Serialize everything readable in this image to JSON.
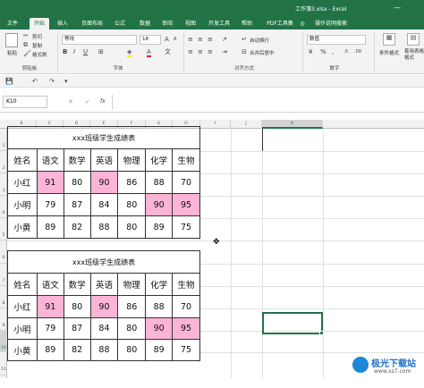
{
  "window": {
    "title": "工作簿3.xlsx - Excel"
  },
  "tabs": [
    {
      "label": "文件"
    },
    {
      "label": "开始"
    },
    {
      "label": "插入"
    },
    {
      "label": "页面布局"
    },
    {
      "label": "公式"
    },
    {
      "label": "数据"
    },
    {
      "label": "审阅"
    },
    {
      "label": "视图"
    },
    {
      "label": "开发工具"
    },
    {
      "label": "帮助"
    },
    {
      "label": "PDF工具集"
    },
    {
      "label": "操作说明搜索"
    }
  ],
  "ribbon": {
    "paste": "粘贴",
    "cut": "剪切",
    "copy": "复制",
    "format_painter": "格式刷",
    "clipboard_group": "剪贴板",
    "font_name": "等线",
    "font_size": "18",
    "font_group": "字体",
    "wrap_text": "自动换行",
    "merge_center": "合并后居中",
    "alignment_group": "对齐方式",
    "number_format": "数值",
    "number_group": "数字",
    "conditional_format": "条件格式",
    "table_format": "套用表格格式",
    "bold": "B",
    "italic": "I",
    "underline": "U"
  },
  "formula_bar": {
    "name_box": "K10",
    "fx": "fx",
    "cancel": "✕",
    "confirm": "✓"
  },
  "columns": [
    "B",
    "C",
    "D",
    "E",
    "F",
    "G",
    "H",
    "I",
    "J",
    "K"
  ],
  "rows": [
    "1",
    "2",
    "3",
    "4",
    "5",
    "6",
    "7",
    "8",
    "9",
    "10",
    "11"
  ],
  "table1": {
    "title": "xxx班级学生成绩表",
    "header": [
      "姓名",
      "语文",
      "数学",
      "英语",
      "物理",
      "化学",
      "生物"
    ],
    "rows": [
      [
        "小红",
        "91",
        "80",
        "90",
        "86",
        "88",
        "70"
      ],
      [
        "小明",
        "79",
        "87",
        "84",
        "80",
        "90",
        "95"
      ],
      [
        "小黄",
        "89",
        "82",
        "88",
        "80",
        "89",
        "75"
      ]
    ]
  },
  "table2": {
    "title": "xxx班级学生成绩表",
    "header": [
      "姓名",
      "语文",
      "数学",
      "英语",
      "物理",
      "化学",
      "生物"
    ],
    "rows": [
      [
        "小红",
        "91",
        "80",
        "90",
        "86",
        "88",
        "70"
      ],
      [
        "小明",
        "79",
        "87",
        "84",
        "80",
        "90",
        "95"
      ],
      [
        "小黄",
        "89",
        "82",
        "88",
        "80",
        "89",
        "75"
      ]
    ]
  },
  "highlight_color": "#fbb4d6",
  "accent_color": "#217346",
  "watermark": {
    "text": "极光下载站",
    "url": "www.xz7.com"
  }
}
